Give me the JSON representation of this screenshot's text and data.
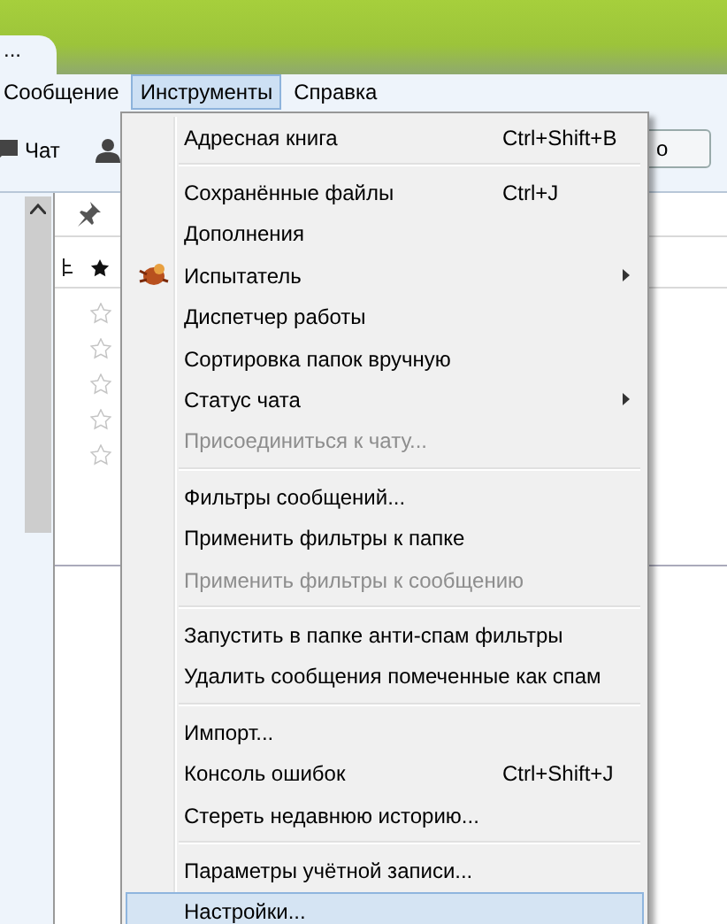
{
  "tab": {
    "title": "..."
  },
  "menubar": [
    {
      "label": "Сообщение",
      "selected": false
    },
    {
      "label": "Инструменты",
      "selected": true
    },
    {
      "label": "Справка",
      "selected": false
    }
  ],
  "toolbar": {
    "chat": "Чат",
    "cut_button": "о"
  },
  "message_list": {
    "rows": [
      {
        "starred": false
      },
      {
        "starred": false
      },
      {
        "starred": false
      },
      {
        "starred": false
      },
      {
        "starred": false
      }
    ]
  },
  "menu": [
    {
      "kind": "item",
      "label": "Адресная книга",
      "shortcut": "Ctrl+Shift+B",
      "submenu": false,
      "disabled": false,
      "selected": false,
      "icon": false
    },
    {
      "kind": "separator"
    },
    {
      "kind": "item",
      "label": "Сохранённые файлы",
      "shortcut": "Ctrl+J",
      "submenu": false,
      "disabled": false,
      "selected": false,
      "icon": false
    },
    {
      "kind": "item",
      "label": "Дополнения",
      "submenu": false,
      "disabled": false,
      "selected": false,
      "icon": false
    },
    {
      "kind": "item",
      "label": "Испытатель",
      "submenu": true,
      "disabled": false,
      "selected": false,
      "icon": true
    },
    {
      "kind": "item",
      "label": "Диспетчер работы",
      "submenu": false,
      "disabled": false,
      "selected": false,
      "icon": false
    },
    {
      "kind": "item",
      "label": "Сортировка папок вручную",
      "submenu": false,
      "disabled": false,
      "selected": false,
      "icon": false
    },
    {
      "kind": "item",
      "label": "Статус чата",
      "submenu": true,
      "disabled": false,
      "selected": false,
      "icon": false
    },
    {
      "kind": "item",
      "label": "Присоединиться к чату...",
      "submenu": false,
      "disabled": true,
      "selected": false,
      "icon": false
    },
    {
      "kind": "separator"
    },
    {
      "kind": "item",
      "label": "Фильтры сообщений...",
      "submenu": false,
      "disabled": false,
      "selected": false,
      "icon": false
    },
    {
      "kind": "item",
      "label": "Применить фильтры к папке",
      "submenu": false,
      "disabled": false,
      "selected": false,
      "icon": false
    },
    {
      "kind": "item",
      "label": "Применить фильтры к сообщению",
      "submenu": false,
      "disabled": true,
      "selected": false,
      "icon": false
    },
    {
      "kind": "separator"
    },
    {
      "kind": "item",
      "label": "Запустить в папке анти-спам фильтры",
      "submenu": false,
      "disabled": false,
      "selected": false,
      "icon": false
    },
    {
      "kind": "item",
      "label": "Удалить сообщения помеченные как спам",
      "submenu": false,
      "disabled": false,
      "selected": false,
      "icon": false
    },
    {
      "kind": "separator"
    },
    {
      "kind": "item",
      "label": "Импорт...",
      "submenu": false,
      "disabled": false,
      "selected": false,
      "icon": false
    },
    {
      "kind": "item",
      "label": "Консоль ошибок",
      "shortcut": "Ctrl+Shift+J",
      "submenu": false,
      "disabled": false,
      "selected": false,
      "icon": false
    },
    {
      "kind": "item",
      "label": "Стереть недавнюю историю...",
      "submenu": false,
      "disabled": false,
      "selected": false,
      "icon": false
    },
    {
      "kind": "separator"
    },
    {
      "kind": "item",
      "label": "Параметры учётной записи...",
      "submenu": false,
      "disabled": false,
      "selected": false,
      "icon": false
    },
    {
      "kind": "item",
      "label": "Настройки...",
      "submenu": false,
      "disabled": false,
      "selected": true,
      "icon": false
    }
  ]
}
